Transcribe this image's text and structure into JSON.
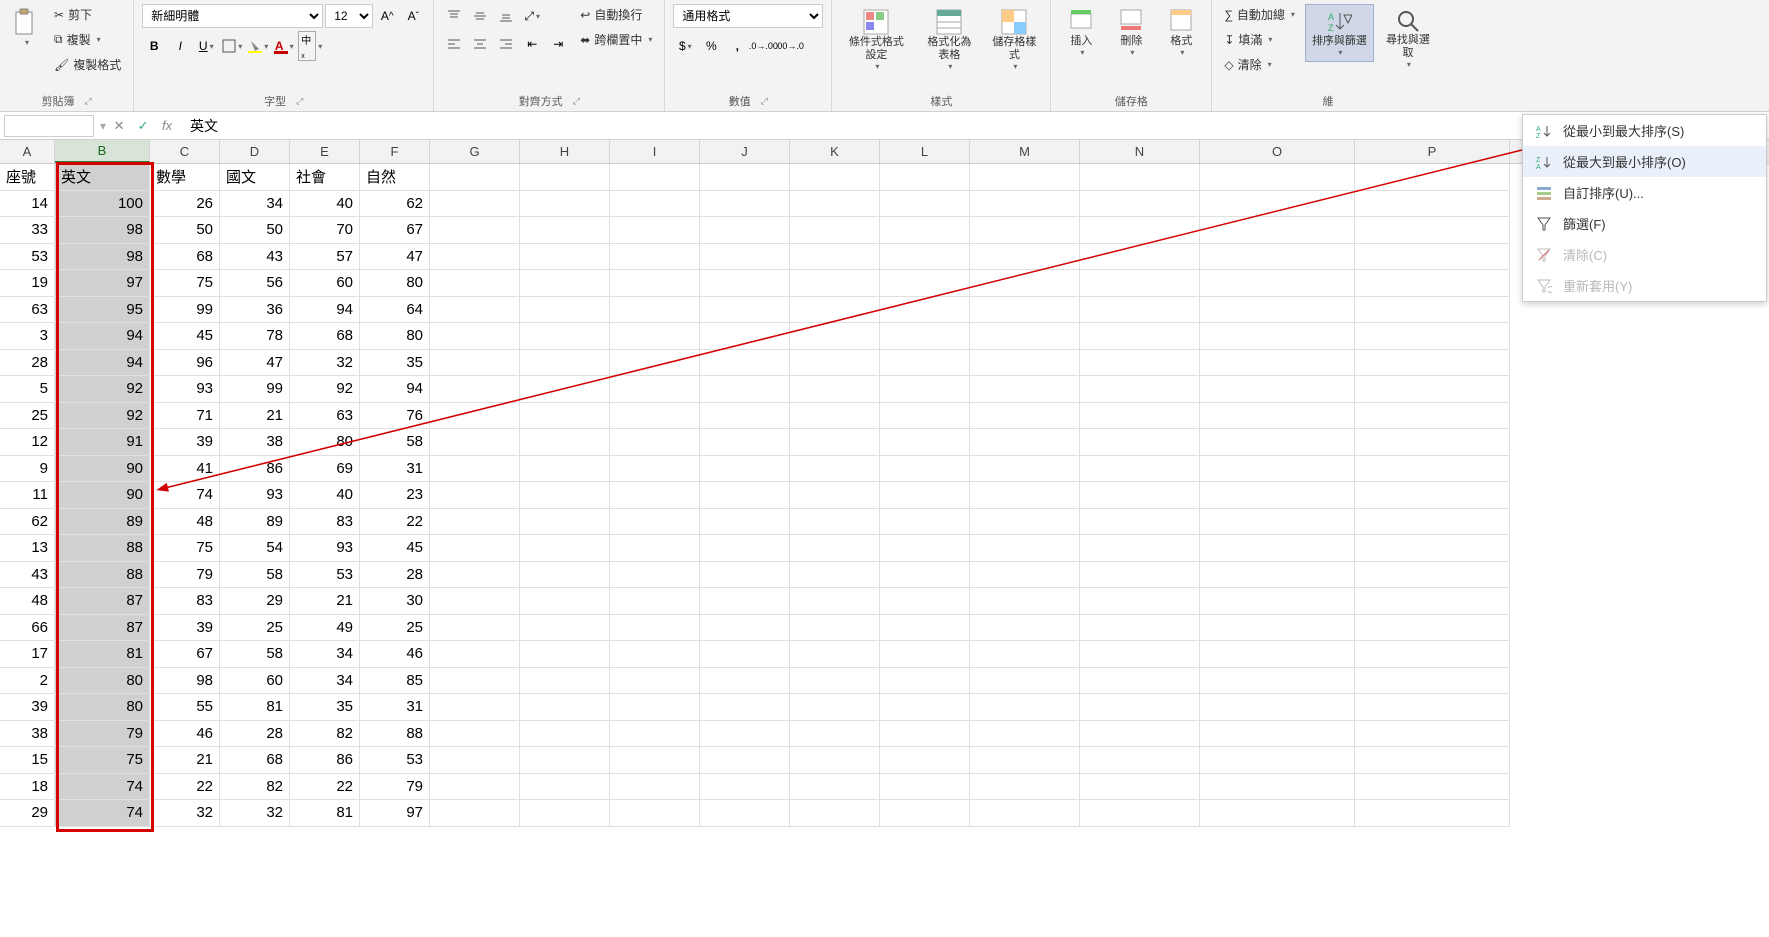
{
  "ribbon": {
    "clipboard": {
      "label": "剪貼簿",
      "cut": "剪下",
      "copy": "複製",
      "format_painter": "複製格式"
    },
    "font": {
      "label": "字型",
      "name": "新細明體",
      "size": "12",
      "bold": "B",
      "italic": "I",
      "underline": "U"
    },
    "alignment": {
      "label": "對齊方式",
      "wrap": "自動換行",
      "merge": "跨欄置中"
    },
    "number": {
      "label": "數值",
      "format": "通用格式"
    },
    "styles": {
      "label": "樣式",
      "conditional": "條件式格式設定",
      "as_table": "格式化為表格",
      "cell_styles": "儲存格樣式"
    },
    "cells": {
      "label": "儲存格",
      "insert": "插入",
      "delete": "刪除",
      "format": "格式"
    },
    "editing": {
      "autosum": "自動加總",
      "fill": "填滿",
      "clear": "清除",
      "sort_filter": "排序與篩選",
      "find_select": "尋找與選取"
    }
  },
  "sort_menu": {
    "asc": "從最小到最大排序(S)",
    "desc": "從最大到最小排序(O)",
    "custom": "自訂排序(U)...",
    "filter": "篩選(F)",
    "clear": "清除(C)",
    "reapply": "重新套用(Y)"
  },
  "formula_bar": {
    "cell_ref": "",
    "value": "英文"
  },
  "columns": [
    "A",
    "B",
    "C",
    "D",
    "E",
    "F",
    "G",
    "H",
    "I",
    "J",
    "K",
    "L",
    "M",
    "N",
    "O",
    "P"
  ],
  "headers": {
    "A": "座號",
    "B": "英文",
    "C": "數學",
    "D": "國文",
    "E": "社會",
    "F": "自然"
  },
  "rows": [
    {
      "A": 14,
      "B": 100,
      "C": 26,
      "D": 34,
      "E": 40,
      "F": 62
    },
    {
      "A": 33,
      "B": 98,
      "C": 50,
      "D": 50,
      "E": 70,
      "F": 67
    },
    {
      "A": 53,
      "B": 98,
      "C": 68,
      "D": 43,
      "E": 57,
      "F": 47
    },
    {
      "A": 19,
      "B": 97,
      "C": 75,
      "D": 56,
      "E": 60,
      "F": 80
    },
    {
      "A": 63,
      "B": 95,
      "C": 99,
      "D": 36,
      "E": 94,
      "F": 64
    },
    {
      "A": 3,
      "B": 94,
      "C": 45,
      "D": 78,
      "E": 68,
      "F": 80
    },
    {
      "A": 28,
      "B": 94,
      "C": 96,
      "D": 47,
      "E": 32,
      "F": 35
    },
    {
      "A": 5,
      "B": 92,
      "C": 93,
      "D": 99,
      "E": 92,
      "F": 94
    },
    {
      "A": 25,
      "B": 92,
      "C": 71,
      "D": 21,
      "E": 63,
      "F": 76
    },
    {
      "A": 12,
      "B": 91,
      "C": 39,
      "D": 38,
      "E": 80,
      "F": 58
    },
    {
      "A": 9,
      "B": 90,
      "C": 41,
      "D": 86,
      "E": 69,
      "F": 31
    },
    {
      "A": 11,
      "B": 90,
      "C": 74,
      "D": 93,
      "E": 40,
      "F": 23
    },
    {
      "A": 62,
      "B": 89,
      "C": 48,
      "D": 89,
      "E": 83,
      "F": 22
    },
    {
      "A": 13,
      "B": 88,
      "C": 75,
      "D": 54,
      "E": 93,
      "F": 45
    },
    {
      "A": 43,
      "B": 88,
      "C": 79,
      "D": 58,
      "E": 53,
      "F": 28
    },
    {
      "A": 48,
      "B": 87,
      "C": 83,
      "D": 29,
      "E": 21,
      "F": 30
    },
    {
      "A": 66,
      "B": 87,
      "C": 39,
      "D": 25,
      "E": 49,
      "F": 25
    },
    {
      "A": 17,
      "B": 81,
      "C": 67,
      "D": 58,
      "E": 34,
      "F": 46
    },
    {
      "A": 2,
      "B": 80,
      "C": 98,
      "D": 60,
      "E": 34,
      "F": 85
    },
    {
      "A": 39,
      "B": 80,
      "C": 55,
      "D": 81,
      "E": 35,
      "F": 31
    },
    {
      "A": 38,
      "B": 79,
      "C": 46,
      "D": 28,
      "E": 82,
      "F": 88
    },
    {
      "A": 15,
      "B": 75,
      "C": 21,
      "D": 68,
      "E": 86,
      "F": 53
    },
    {
      "A": 18,
      "B": 74,
      "C": 22,
      "D": 82,
      "E": 22,
      "F": 79
    },
    {
      "A": 29,
      "B": 74,
      "C": 32,
      "D": 32,
      "E": 81,
      "F": 97
    }
  ]
}
